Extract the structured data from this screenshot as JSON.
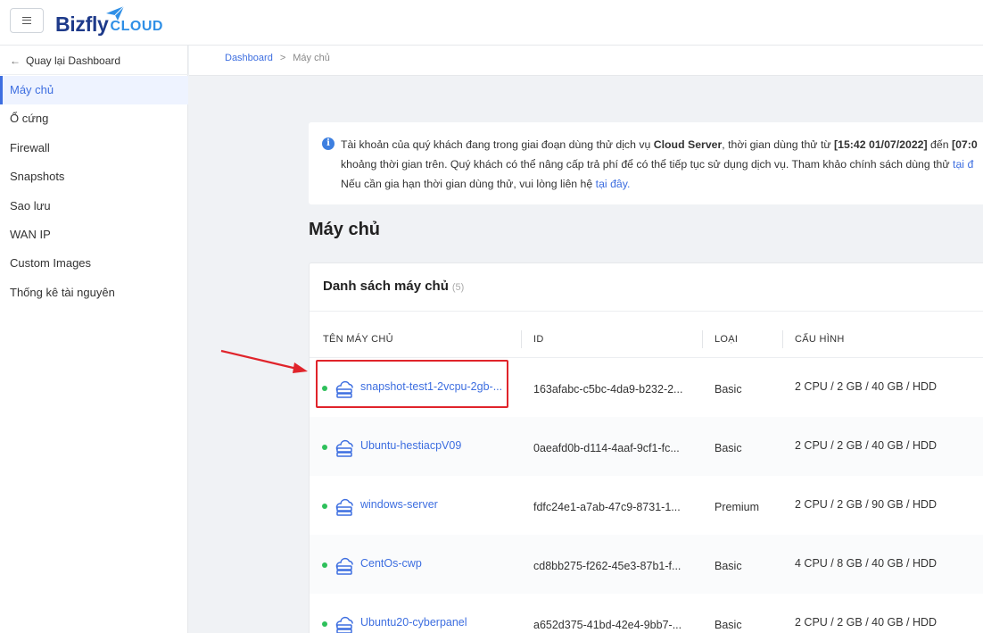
{
  "header": {
    "logo_text": "Bizfly",
    "logo_suffix": "CLOUD"
  },
  "sidebar": {
    "back_label": "Quay lại Dashboard",
    "items": [
      {
        "label": "Máy chủ",
        "active": true
      },
      {
        "label": "Ổ cứng"
      },
      {
        "label": "Firewall"
      },
      {
        "label": "Snapshots"
      },
      {
        "label": "Sao lưu"
      },
      {
        "label": "WAN IP"
      },
      {
        "label": "Custom Images"
      },
      {
        "label": "Thống kê tài nguyên"
      }
    ]
  },
  "breadcrumb": {
    "root": "Dashboard",
    "separator": ">",
    "current": "Máy chủ"
  },
  "notice": {
    "l1_a": "Tài khoản của quý khách đang trong giai đoạn dùng thử dịch vụ ",
    "l1_b": "Cloud Server",
    "l1_c": ", thời gian dùng thử từ ",
    "l1_d": "[15:42 01/07/2022]",
    "l1_e": " đến ",
    "l1_f": "[07:0",
    "l2_a": "khoảng thời gian trên. Quý khách có thể nâng cấp trả phí để có thể tiếp tục sử dụng dịch vụ. Tham khảo chính sách dùng thử ",
    "l2_link": "tại đ",
    "l3_a": "Nếu cần gia hạn thời gian dùng thử, vui lòng liên hệ ",
    "l3_link": "tại đây."
  },
  "page_title": "Máy chủ",
  "list": {
    "title": "Danh sách máy chủ",
    "count": "(5)",
    "columns": {
      "name": "TÊN MÁY CHỦ",
      "id": "ID",
      "type": "LOẠI",
      "config": "CẤU HÌNH"
    },
    "rows": [
      {
        "name": "snapshot-test1-2vcpu-2gb-...",
        "id": "163afabc-c5bc-4da9-b232-2...",
        "type": "Basic",
        "config": "2 CPU / 2 GB / 40 GB / HDD"
      },
      {
        "name": "Ubuntu-hestiacpV09",
        "id": "0aeafd0b-d114-4aaf-9cf1-fc...",
        "type": "Basic",
        "config": "2 CPU / 2 GB / 40 GB / HDD"
      },
      {
        "name": "windows-server",
        "id": "fdfc24e1-a7ab-47c9-8731-1...",
        "type": "Premium",
        "config": "2 CPU / 2 GB / 90 GB / HDD"
      },
      {
        "name": "CentOs-cwp",
        "id": "cd8bb275-f262-45e3-87b1-f...",
        "type": "Basic",
        "config": "4 CPU / 8 GB / 40 GB / HDD"
      },
      {
        "name": "Ubuntu20-cyberpanel",
        "id": "a652d375-41bd-42e4-9bb7-...",
        "type": "Basic",
        "config": "2 CPU / 2 GB / 40 GB / HDD"
      }
    ]
  },
  "colors": {
    "accent": "#3d6ee0",
    "status_running": "#2ec05b",
    "annotation": "#e0242b"
  }
}
